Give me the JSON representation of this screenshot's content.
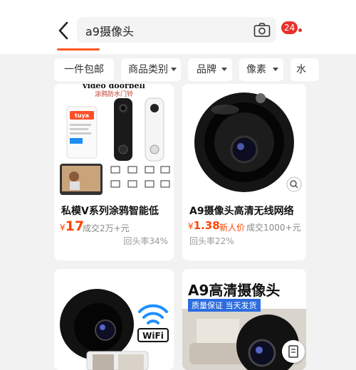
{
  "header": {
    "search_query": "a9摄像头",
    "notification_count": "24"
  },
  "filters": [
    {
      "label": "一件包邮"
    },
    {
      "label": "商品类别"
    },
    {
      "label": "品牌"
    },
    {
      "label": "像素"
    },
    {
      "label": "水"
    }
  ],
  "products": [
    {
      "banner_title": "video doorbell",
      "banner_subtitle": "涂鸦防水门铃",
      "brand_logo": "tuya",
      "title": "私模V系列涂鸦智能低",
      "currency": "¥",
      "price": "17",
      "sold": "成交2万+元",
      "repurchase": "回头率34%"
    },
    {
      "title": "A9摄像头高清无线网络",
      "currency": "¥",
      "price": "1.38",
      "tag": "新人价",
      "sold": "成交1000+元",
      "repurchase": "回头率22%"
    },
    {
      "wifi_label": "WiFi"
    },
    {
      "banner_title": "A9高清摄像头",
      "badge": "质量保证 当天发货"
    }
  ]
}
